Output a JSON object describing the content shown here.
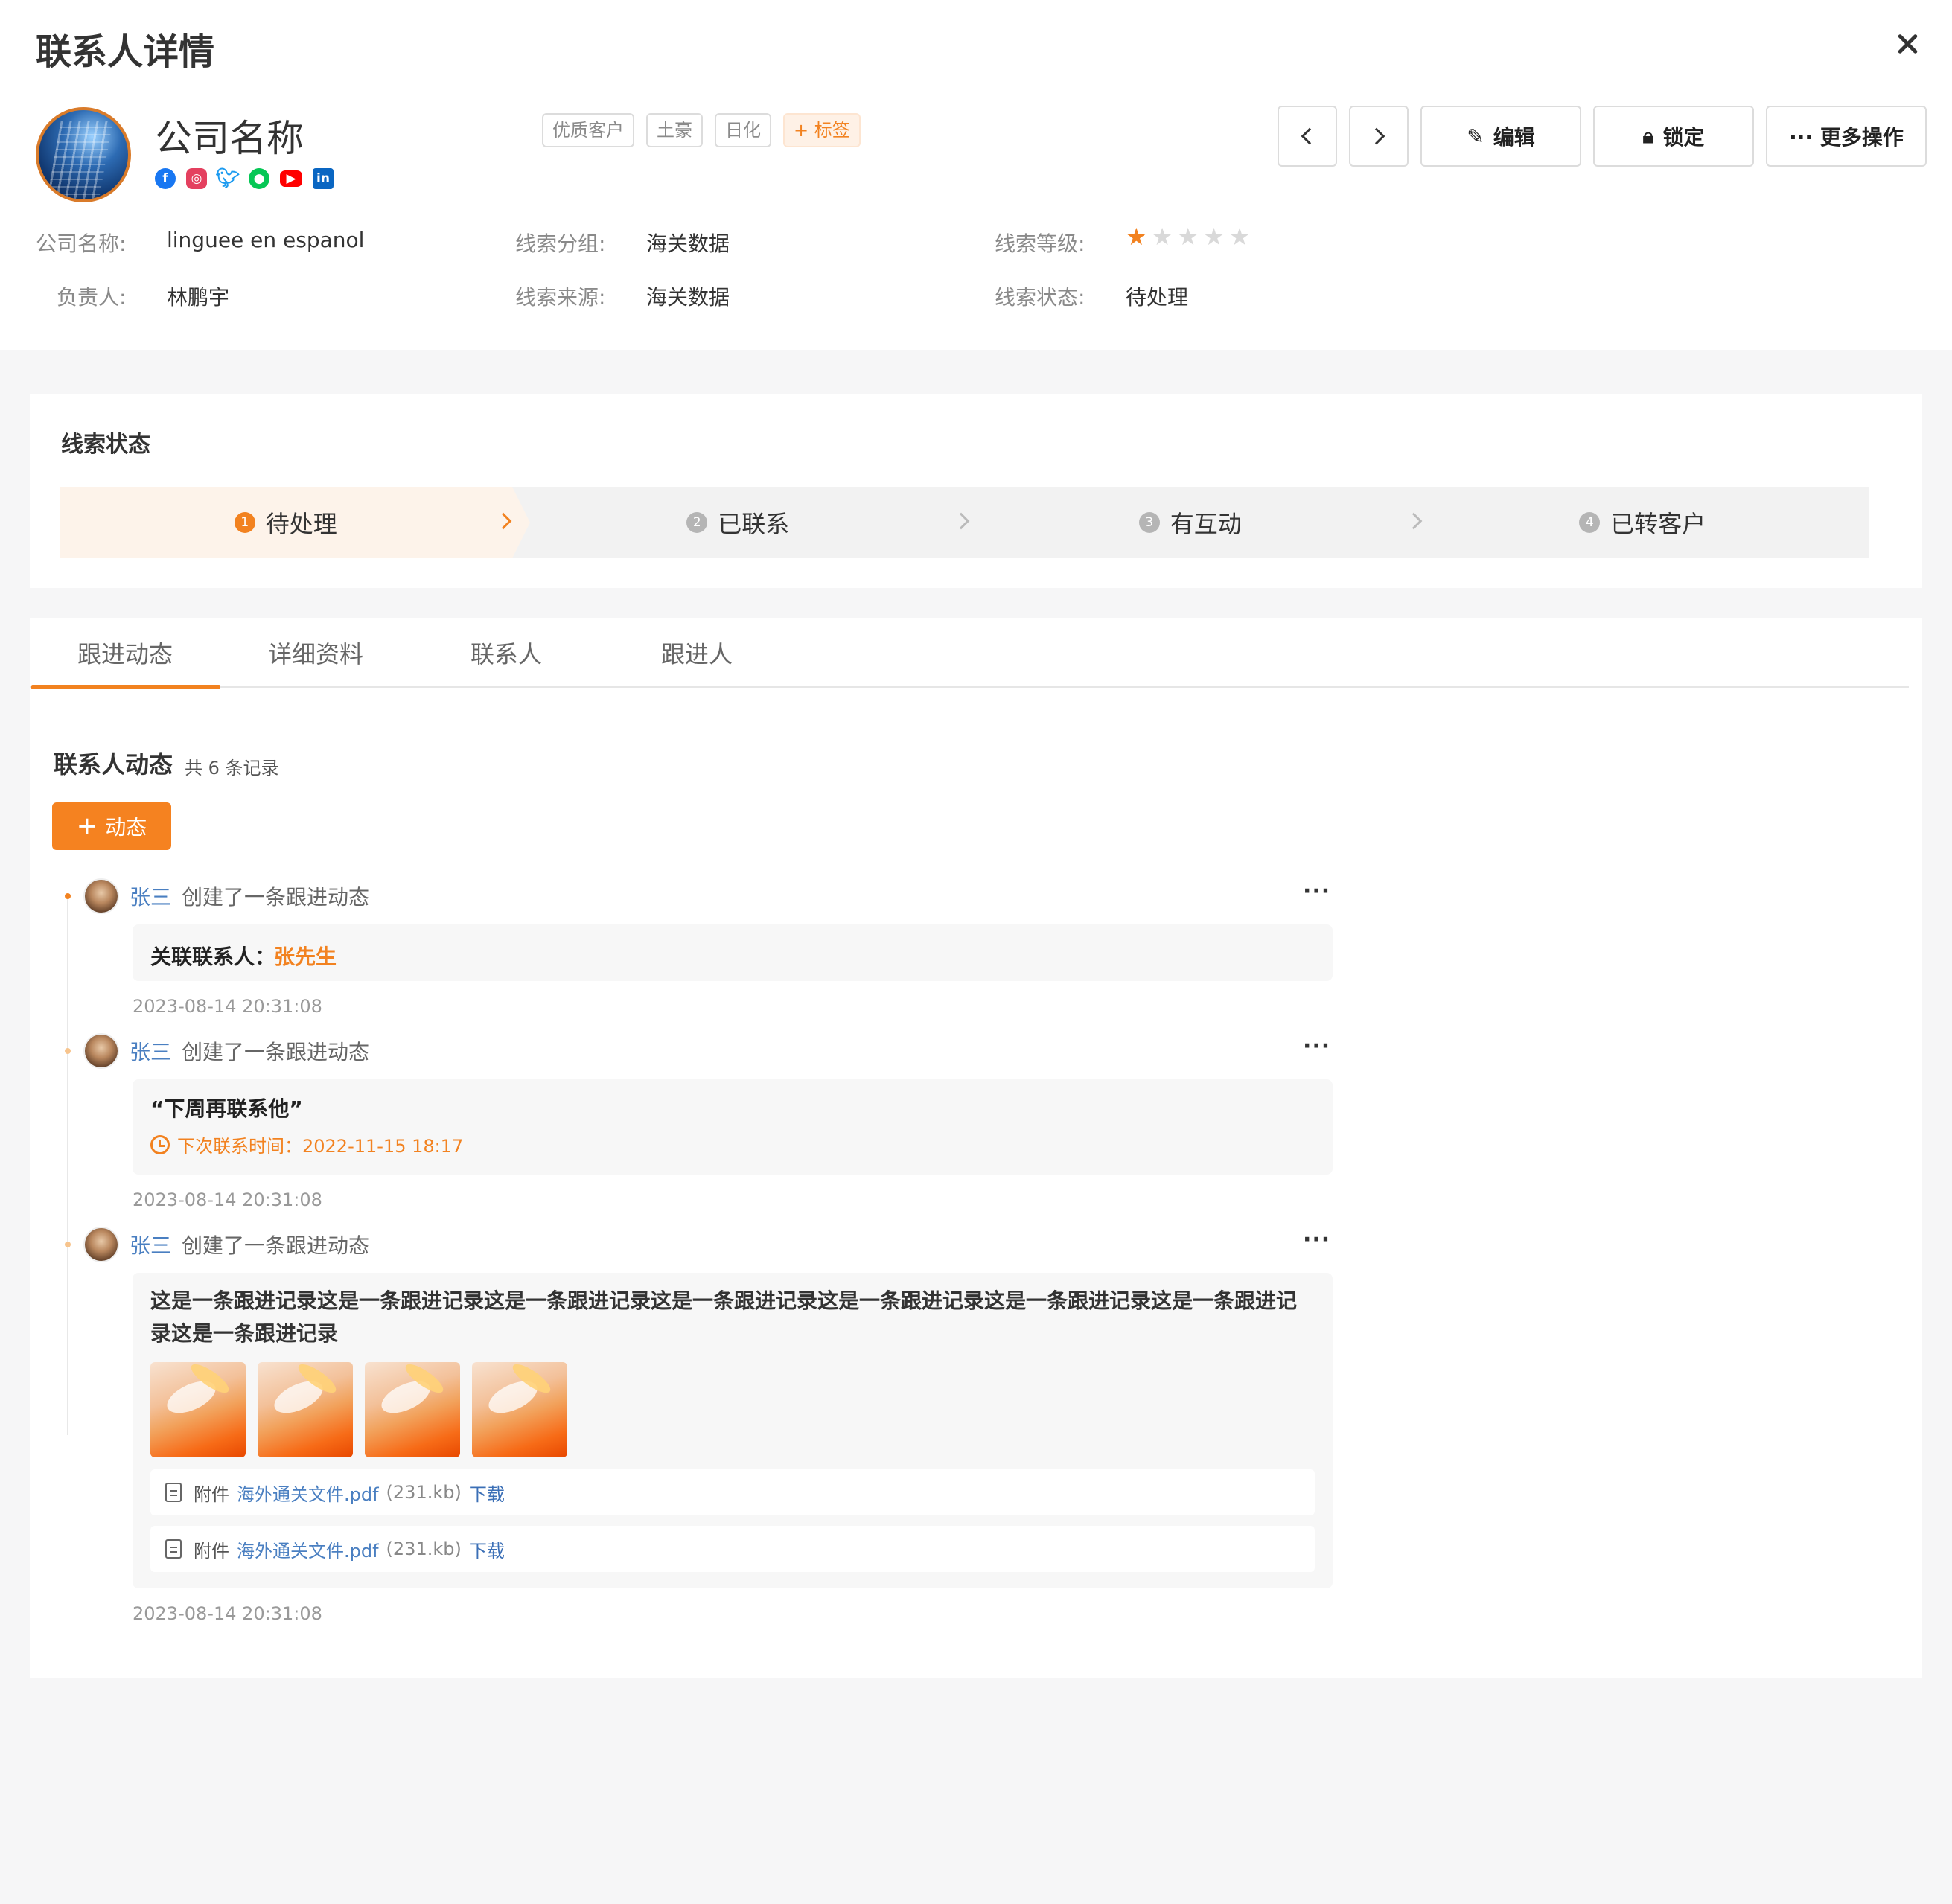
{
  "page_title": "联系人详情",
  "company": {
    "name": "公司名称",
    "social_icons": [
      "facebook-icon",
      "instagram-icon",
      "twitter-icon",
      "line-icon",
      "youtube-icon",
      "linkedin-icon"
    ]
  },
  "tags": [
    "优质客户",
    "土豪",
    "日化"
  ],
  "tag_add_label": "+ 标签",
  "actions": {
    "edit": "编辑",
    "lock": "锁定",
    "more": "··· 更多操作"
  },
  "info": {
    "company_name_label": "公司名称:",
    "company_name_value": "linguee en espanol",
    "owner_label": "负责人:",
    "owner_value": "林鹏宇",
    "group_label": "线索分组:",
    "group_value": "海关数据",
    "source_label": "线索来源:",
    "source_value": "海关数据",
    "level_label": "线索等级:",
    "level_stars": 1,
    "level_max": 5,
    "status_label": "线索状态:",
    "status_value": "待处理"
  },
  "status_section": {
    "title": "线索状态",
    "steps": [
      {
        "num": "1",
        "label": "待处理"
      },
      {
        "num": "2",
        "label": "已联系"
      },
      {
        "num": "3",
        "label": "有互动"
      },
      {
        "num": "4",
        "label": "已转客户"
      }
    ],
    "active_index": 0
  },
  "tabs": [
    "跟进动态",
    "详细资料",
    "联系人",
    "跟进人"
  ],
  "feed": {
    "title": "联系人动态",
    "count": "共 6 条记录",
    "add_label": "动态",
    "entries": [
      {
        "user": "张三",
        "action": "创建了一条跟进动态",
        "related_label": "关联联系人：",
        "related_value": "张先生",
        "time": "2023-08-14 20:31:08"
      },
      {
        "user": "张三",
        "action": "创建了一条跟进动态",
        "quote": "“下周再联系他”",
        "next_contact": "下次联系时间：2022-11-15 18:17",
        "time": "2023-08-14 20:31:08"
      },
      {
        "user": "张三",
        "action": "创建了一条跟进动态",
        "text": "这是一条跟进记录这是一条跟进记录这是一条跟进记录这是一条跟进记录这是一条跟进记录这是一条跟进记录这是一条跟进记录这是一条跟进记录",
        "attachments": [
          {
            "label": "附件",
            "name": "海外通关文件.pdf",
            "size": "(231.kb)",
            "download": "下载"
          },
          {
            "label": "附件",
            "name": "海外通关文件.pdf",
            "size": "(231.kb)",
            "download": "下载"
          }
        ],
        "time": "2023-08-14 20:31:08"
      }
    ]
  }
}
